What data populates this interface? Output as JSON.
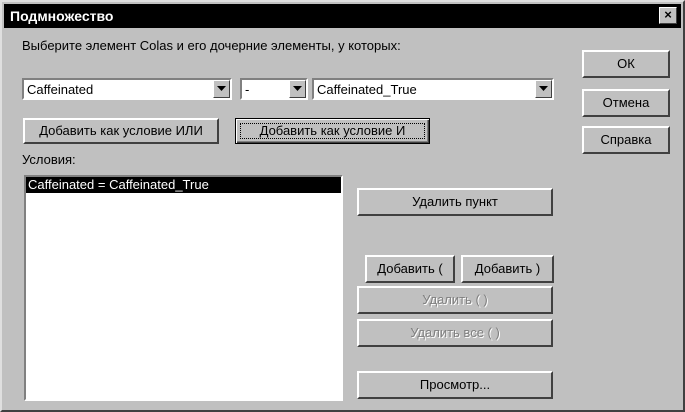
{
  "window": {
    "title": "Подмножество",
    "close_glyph": "×"
  },
  "instruction": "Выберите элемент Colas и его дочерние элементы, у которых:",
  "combos": {
    "element": "Caffeinated",
    "operator": "-",
    "value": "Caffeinated_True"
  },
  "buttons": {
    "add_or": "Добавить как условие ИЛИ",
    "add_and": "Добавить как условие И",
    "ok": "ОК",
    "cancel": "Отмена",
    "help": "Справка",
    "delete_item": "Удалить пункт",
    "add_open_paren": "Добавить (",
    "add_close_paren": "Добавить )",
    "delete_parens": "Удалить ( )",
    "delete_all_parens": "Удалить все ( )",
    "preview": "Просмотр..."
  },
  "conditions": {
    "label": "Условия:",
    "items": [
      {
        "text": "Caffeinated = Caffeinated_True",
        "selected": true
      }
    ]
  },
  "icons": {
    "dropdown": "chevron-down-icon",
    "close": "close-icon"
  }
}
